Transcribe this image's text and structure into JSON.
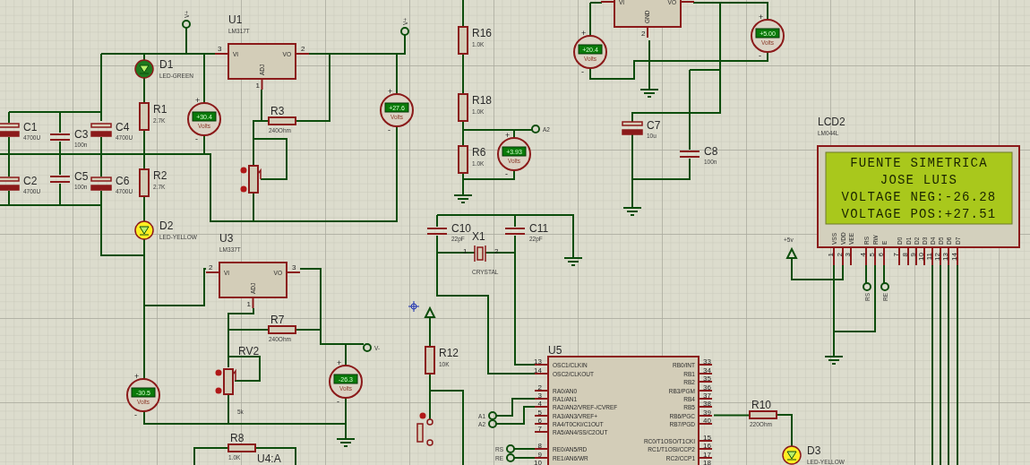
{
  "resistors": [
    {
      "designator": "R1",
      "value": "2.7K"
    },
    {
      "designator": "R2",
      "value": "2.7K"
    },
    {
      "designator": "R3",
      "value": "240Ohm"
    },
    {
      "designator": "R7",
      "value": "240Ohm"
    },
    {
      "designator": "R8",
      "value": "1.0K"
    },
    {
      "designator": "R16",
      "value": "1.0K"
    },
    {
      "designator": "R18",
      "value": "1.0K"
    },
    {
      "designator": "R6",
      "value": "1.0K"
    },
    {
      "designator": "R12",
      "value": "10K"
    },
    {
      "designator": "R10",
      "value": "220Ohm"
    }
  ],
  "capacitors": [
    {
      "designator": "C1",
      "value": "4700U",
      "kind": "electrolytic"
    },
    {
      "designator": "C2",
      "value": "4700U",
      "kind": "electrolytic"
    },
    {
      "designator": "C3",
      "value": "100n",
      "kind": "ceramic"
    },
    {
      "designator": "C5",
      "value": "100n",
      "kind": "ceramic"
    },
    {
      "designator": "C4",
      "value": "4700U",
      "kind": "electrolytic"
    },
    {
      "designator": "C6",
      "value": "4700U",
      "kind": "electrolytic"
    },
    {
      "designator": "C7",
      "value": "10u",
      "kind": "electrolytic"
    },
    {
      "designator": "C8",
      "value": "100n",
      "kind": "ceramic"
    },
    {
      "designator": "C10",
      "value": "22pF",
      "kind": "ceramic"
    },
    {
      "designator": "C11",
      "value": "22pF",
      "kind": "ceramic"
    }
  ],
  "leds": [
    {
      "designator": "D1",
      "value": "LED-GREEN",
      "color": "#1f7a1f"
    },
    {
      "designator": "D2",
      "value": "LED-YELLOW",
      "color": "#ffee22"
    },
    {
      "designator": "D3",
      "value": "LED-YELLOW",
      "color": "#ffee22"
    }
  ],
  "regulators": [
    {
      "designator": "U1",
      "part": "LM317T",
      "pins": [
        {
          "number": "3",
          "name": "VI"
        },
        {
          "number": "2",
          "name": "VO"
        },
        {
          "number": "1",
          "name": "ADJ"
        }
      ]
    },
    {
      "designator": "U3",
      "part": "LM337T",
      "pins": [
        {
          "number": "2",
          "name": "VI"
        },
        {
          "number": "3",
          "name": "VO"
        },
        {
          "number": "1",
          "name": "ADJ"
        }
      ]
    },
    {
      "pins": [
        {
          "name": "VI"
        },
        {
          "name": "VO"
        },
        {
          "number": "2",
          "name": "GND"
        }
      ]
    }
  ],
  "voltmeters": [
    {
      "reading": "+30.4",
      "unit": "Volts",
      "plus": "+",
      "minus": "-"
    },
    {
      "reading": "+27.6",
      "unit": "Volts",
      "plus": "+",
      "minus": "-"
    },
    {
      "reading": "-30.5",
      "unit": "Volts",
      "plus": "+",
      "minus": "-"
    },
    {
      "reading": "-26.3",
      "unit": "Volts",
      "plus": "+",
      "minus": "-"
    },
    {
      "reading": "+3.93",
      "unit": "Volts",
      "plus": "+",
      "minus": "-"
    },
    {
      "reading": "+20.4",
      "unit": "Volts",
      "plus": "+",
      "minus": "-"
    },
    {
      "reading": "+5.00",
      "unit": "Volts",
      "plus": "+",
      "minus": "-"
    }
  ],
  "potentiometers": [
    {
      "designator": "RV2",
      "value": "5k"
    }
  ],
  "crystal": {
    "designator": "X1",
    "value": "CRYSTAL",
    "pin_1": "1",
    "pin_2": "2"
  },
  "partial_part": {
    "designator": "U4:A"
  },
  "mcu": {
    "designator": "U5",
    "left_pins": [
      {
        "number": "13",
        "name": "OSC1/CLKIN"
      },
      {
        "number": "14",
        "name": "OSC2/CLKOUT"
      },
      {
        "number": "2",
        "name": "RA0/AN0"
      },
      {
        "number": "3",
        "name": "RA1/AN1"
      },
      {
        "number": "4",
        "name": "RA2/AN2/VREF-/CVREF"
      },
      {
        "number": "5",
        "name": "RA3/AN3/VREF+"
      },
      {
        "number": "6",
        "name": "RA4/T0CKI/C1OUT"
      },
      {
        "number": "7",
        "name": "RA5/AN4/SS/C2OUT"
      },
      {
        "number": "8",
        "name": "RE0/AN5/RD"
      },
      {
        "number": "9",
        "name": "RE1/AN6/WR"
      },
      {
        "number": "10"
      }
    ],
    "right_pins": [
      {
        "number": "33",
        "name": "RB0/INT"
      },
      {
        "number": "34",
        "name": "RB1"
      },
      {
        "number": "35",
        "name": "RB2"
      },
      {
        "number": "36",
        "name": "RB3/PGM"
      },
      {
        "number": "37",
        "name": "RB4"
      },
      {
        "number": "38",
        "name": "RB5"
      },
      {
        "number": "39",
        "name": "RB6/PGC"
      },
      {
        "number": "40",
        "name": "RB7/PGD"
      },
      {
        "number": "15",
        "name": "RC0/T1OSO/T1CKI"
      },
      {
        "number": "16",
        "name": "RC1/T1OSI/CCP2"
      },
      {
        "number": "17",
        "name": "RC2/CCP1"
      },
      {
        "number": "18"
      }
    ]
  },
  "lcd": {
    "designator": "LCD2",
    "part": "LM044L",
    "lines": [
      "FUENTE SIMETRICA",
      "JOSE LUIS",
      "VOLTAGE NEG:-26.28",
      "VOLTAGE POS:+27.51"
    ],
    "pins": [
      {
        "number": "1",
        "name": "VSS"
      },
      {
        "number": "2",
        "name": "VDD"
      },
      {
        "number": "3",
        "name": "VEE"
      },
      {
        "number": "4",
        "name": "RS"
      },
      {
        "number": "5",
        "name": "RW"
      },
      {
        "number": "6",
        "name": "E"
      },
      {
        "number": "7",
        "name": "D0"
      },
      {
        "number": "8",
        "name": "D1"
      },
      {
        "number": "9",
        "name": "D2"
      },
      {
        "number": "10",
        "name": "D3"
      },
      {
        "number": "11",
        "name": "D4"
      },
      {
        "number": "12",
        "name": "D5"
      },
      {
        "number": "13",
        "name": "D6"
      },
      {
        "number": "14",
        "name": "D7"
      }
    ]
  },
  "terminals": [
    {
      "label": "V+"
    },
    {
      "label": "V+"
    },
    {
      "label": "A2"
    },
    {
      "label": "V-"
    },
    {
      "label": "A1"
    },
    {
      "label": "A2"
    },
    {
      "label": "RS"
    },
    {
      "label": "RE"
    },
    {
      "label": "RS"
    },
    {
      "label": "RE"
    }
  ],
  "power": [
    {
      "label": "+5v"
    }
  ]
}
